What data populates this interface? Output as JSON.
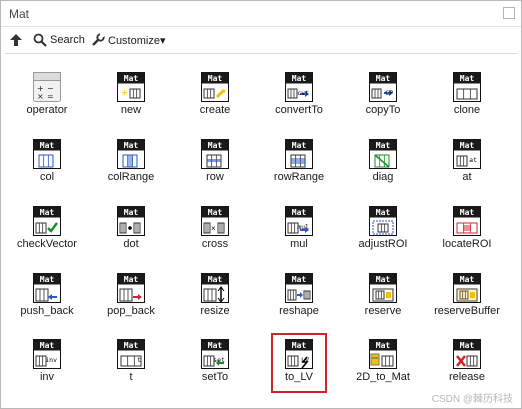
{
  "window": {
    "title": "Mat"
  },
  "toolbar": {
    "up_label": "",
    "search_label": "Search",
    "customize_label": "Customize▾"
  },
  "palette": {
    "items": [
      {
        "label": "operator",
        "glyph": "operator",
        "badge": ""
      },
      {
        "label": "new",
        "glyph": "new",
        "badge": ""
      },
      {
        "label": "create",
        "glyph": "create",
        "badge": ""
      },
      {
        "label": "convertTo",
        "glyph": "convertTo",
        "badge": "cvt"
      },
      {
        "label": "copyTo",
        "glyph": "copyTo",
        "badge": "CP"
      },
      {
        "label": "clone",
        "glyph": "clone",
        "badge": ""
      },
      {
        "label": "col",
        "glyph": "col",
        "badge": ""
      },
      {
        "label": "colRange",
        "glyph": "colRange",
        "badge": ""
      },
      {
        "label": "row",
        "glyph": "row",
        "badge": ""
      },
      {
        "label": "rowRange",
        "glyph": "rowRange",
        "badge": ""
      },
      {
        "label": "diag",
        "glyph": "diag",
        "badge": ""
      },
      {
        "label": "at",
        "glyph": "at",
        "badge": "at"
      },
      {
        "label": "checkVector",
        "glyph": "checkVector",
        "badge": ""
      },
      {
        "label": "dot",
        "glyph": "dot",
        "badge": ""
      },
      {
        "label": "cross",
        "glyph": "cross",
        "badge": ""
      },
      {
        "label": "mul",
        "glyph": "mul",
        "badge": "mul"
      },
      {
        "label": "adjustROI",
        "glyph": "adjustROI",
        "badge": ""
      },
      {
        "label": "locateROI",
        "glyph": "locateROI",
        "badge": ""
      },
      {
        "label": "push_back",
        "glyph": "push_back",
        "badge": ""
      },
      {
        "label": "pop_back",
        "glyph": "pop_back",
        "badge": ""
      },
      {
        "label": "resize",
        "glyph": "resize",
        "badge": ""
      },
      {
        "label": "reshape",
        "glyph": "reshape",
        "badge": ""
      },
      {
        "label": "reserve",
        "glyph": "reserve",
        "badge": ""
      },
      {
        "label": "reserveBuffer",
        "glyph": "reserveBuffer",
        "badge": ""
      },
      {
        "label": "inv",
        "glyph": "inv",
        "badge": "inv"
      },
      {
        "label": "t",
        "glyph": "t",
        "badge": "t"
      },
      {
        "label": "setTo",
        "glyph": "setTo",
        "badge": "set"
      },
      {
        "label": "to_LV",
        "glyph": "to_LV",
        "badge": "LV"
      },
      {
        "label": "2D_to_Mat",
        "glyph": "2D_to_Mat",
        "badge": ""
      },
      {
        "label": "release",
        "glyph": "release",
        "badge": ""
      }
    ],
    "icon_header": "Mat",
    "selected_item": "to_LV"
  },
  "watermark": "CSDN @棘历科技",
  "colors": {
    "icon_header_bg": "#1a1a1a",
    "icon_header_text": "#ffffff",
    "selection_border": "#d0262b",
    "accent_blue": "#2a58c9",
    "accent_green": "#1d8b2a",
    "accent_yellow": "#f2c200",
    "accent_red": "#d0262b"
  }
}
